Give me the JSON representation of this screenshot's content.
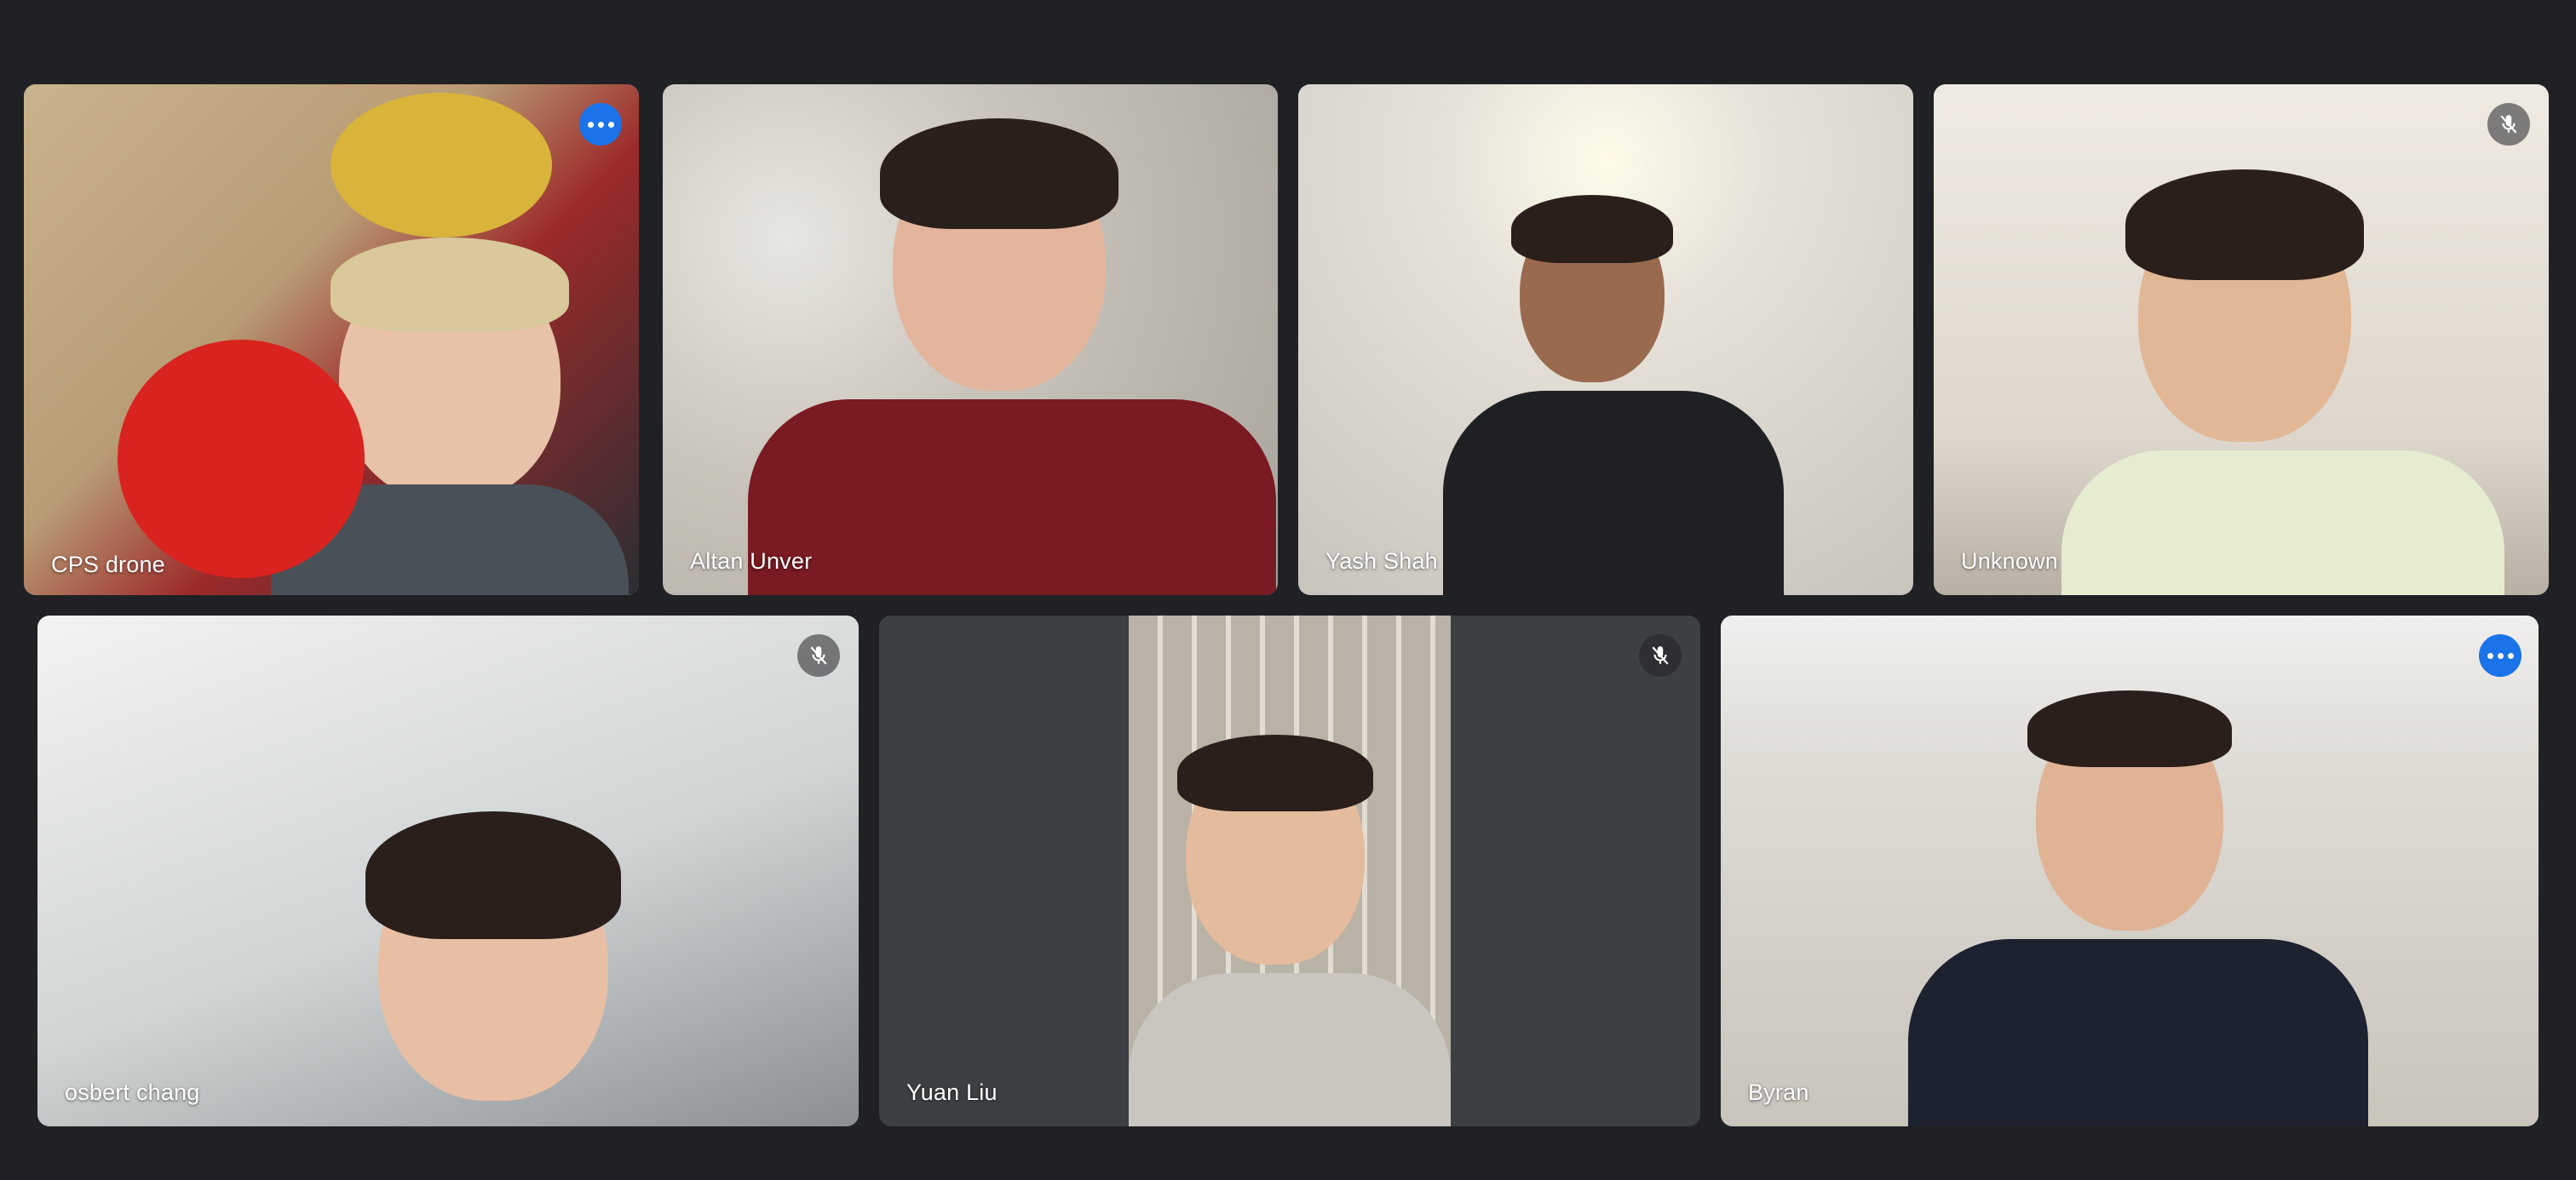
{
  "participants": [
    {
      "name": "CPS drone",
      "muted": false,
      "speaking": true,
      "show_more": true
    },
    {
      "name": "Altan Unver",
      "muted": false,
      "speaking": false,
      "show_more": false
    },
    {
      "name": "Yash Shah",
      "muted": false,
      "speaking": false,
      "show_more": false
    },
    {
      "name": "Unknown",
      "muted": true,
      "speaking": false,
      "show_more": false
    },
    {
      "name": "osbert chang",
      "muted": true,
      "speaking": false,
      "show_more": false
    },
    {
      "name": "Yuan Liu",
      "muted": true,
      "speaking": false,
      "show_more": false
    },
    {
      "name": "Byran",
      "muted": false,
      "speaking": true,
      "show_more": true
    }
  ],
  "icons": {
    "mute": "mic-off-icon",
    "more": "more-options-icon"
  },
  "colors": {
    "background": "#202124",
    "tile_empty": "#3c4043",
    "speaking_outline": "#8ab4f8",
    "more_button": "#1a73e8"
  }
}
